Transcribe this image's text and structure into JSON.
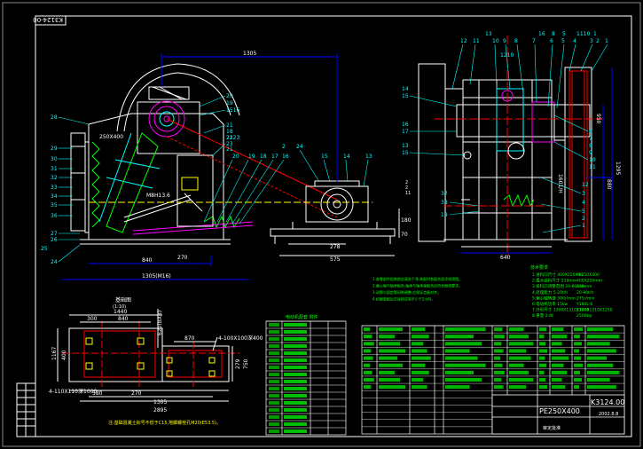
{
  "drawing": {
    "stamp": "K3124-00",
    "model": "PE250X400",
    "drawing_no": "K3124.00",
    "approval": "审定批准",
    "sheet_note": "2002.8.8",
    "footnote": "注:基础混凝土标号不低于C15,地脚螺栓孔M20(E53.5)。"
  },
  "front_view": {
    "dim_top": "1305",
    "dim_bottom_1": "840",
    "dim_bottom_2": "270",
    "dim_overall": "1305(M16)",
    "motor_dims": [
      "278",
      "575"
    ],
    "motor_height": "180",
    "motor_height_2": "70",
    "inner_label": "250X400",
    "shaft_label": "M8H13.6",
    "left_numbers": [
      "28",
      "29",
      "30",
      "31",
      "32",
      "33",
      "34",
      "35",
      "36",
      "27",
      "26",
      "25",
      "24"
    ],
    "right_numbers": [
      "20",
      "19",
      "1516",
      "21",
      "18",
      "22",
      "23",
      "2123",
      "21",
      "20",
      "19",
      "18",
      "17",
      "16",
      "2",
      "24",
      "15",
      "14",
      "13"
    ],
    "right_edge": [
      "2",
      "2",
      "11"
    ]
  },
  "side_view": {
    "top_numbers": [
      "12",
      "11",
      "10",
      "9",
      "8",
      "7",
      "6",
      "5",
      "4",
      "3",
      "2",
      "1"
    ],
    "top_numbers_2": [
      "13",
      "16",
      "8",
      "5",
      "1110",
      "1"
    ],
    "label_1210": "1210",
    "left_numbers": [
      "14",
      "15",
      "16",
      "17",
      "13",
      "15",
      "37",
      "38",
      "19"
    ],
    "right_numbers": [
      "6",
      "7",
      "8",
      "9",
      "10",
      "11",
      "12",
      "3",
      "4",
      "5",
      "2",
      "1"
    ],
    "right_dims": [
      "1295",
      "880",
      "1601/H",
      "950"
    ],
    "bottom_dim": "640"
  },
  "foundation": {
    "title": "基础图",
    "subtitle": "(1:10)",
    "dim_top": "1440",
    "dim_top_2": "840",
    "dim_top_3": "300",
    "dim_right": "620(BX8)",
    "dim_mid": "870",
    "dim_left": "1167",
    "dim_left_2": "400",
    "bolt_left": "4-110X110深1000",
    "bolt_right": "4-100X100深400",
    "dim_bottom_1": "580",
    "dim_bottom_2": "270",
    "dim_bottom_3": "1305",
    "dim_bottom_4": "2895",
    "dim_small_1": "279",
    "dim_small_2": "750"
  },
  "parts_table": {
    "title": "电动机配套  附件",
    "rows": 16
  },
  "spec_block": {
    "heading": "技术要求",
    "lines": [
      "1.进料口尺寸   400X250mm",
      "2.最大给料尺寸  210mm",
      "3.排料口调整范围 20-80mm",
      "4.处理能力   5-20t/h",
      "5.偏心轴转速  300r/min",
      "6.电动机功率  15kw",
      "7.外形尺寸   1300X1310X1260",
      "8.重量     2.8t"
    ],
    "lines_right": [
      "PE250X400",
      "400X250mm",
      "210mm",
      "20-80t/h",
      "275r/min",
      "Y180L-6",
      "1300X1310X1250",
      "2500kg"
    ],
    "notes": [
      "1.各零部件组装前应清洗干净,装配时各配合面涂润滑脂。",
      "2.偏心轴与轴承配合,轴承与轴承座配合应符合图纸要求。",
      "3.动颚与固定颚间隙调整,应保证齿板对齐。",
      "4.机器装配后空运转试验不少于2小时。"
    ]
  }
}
